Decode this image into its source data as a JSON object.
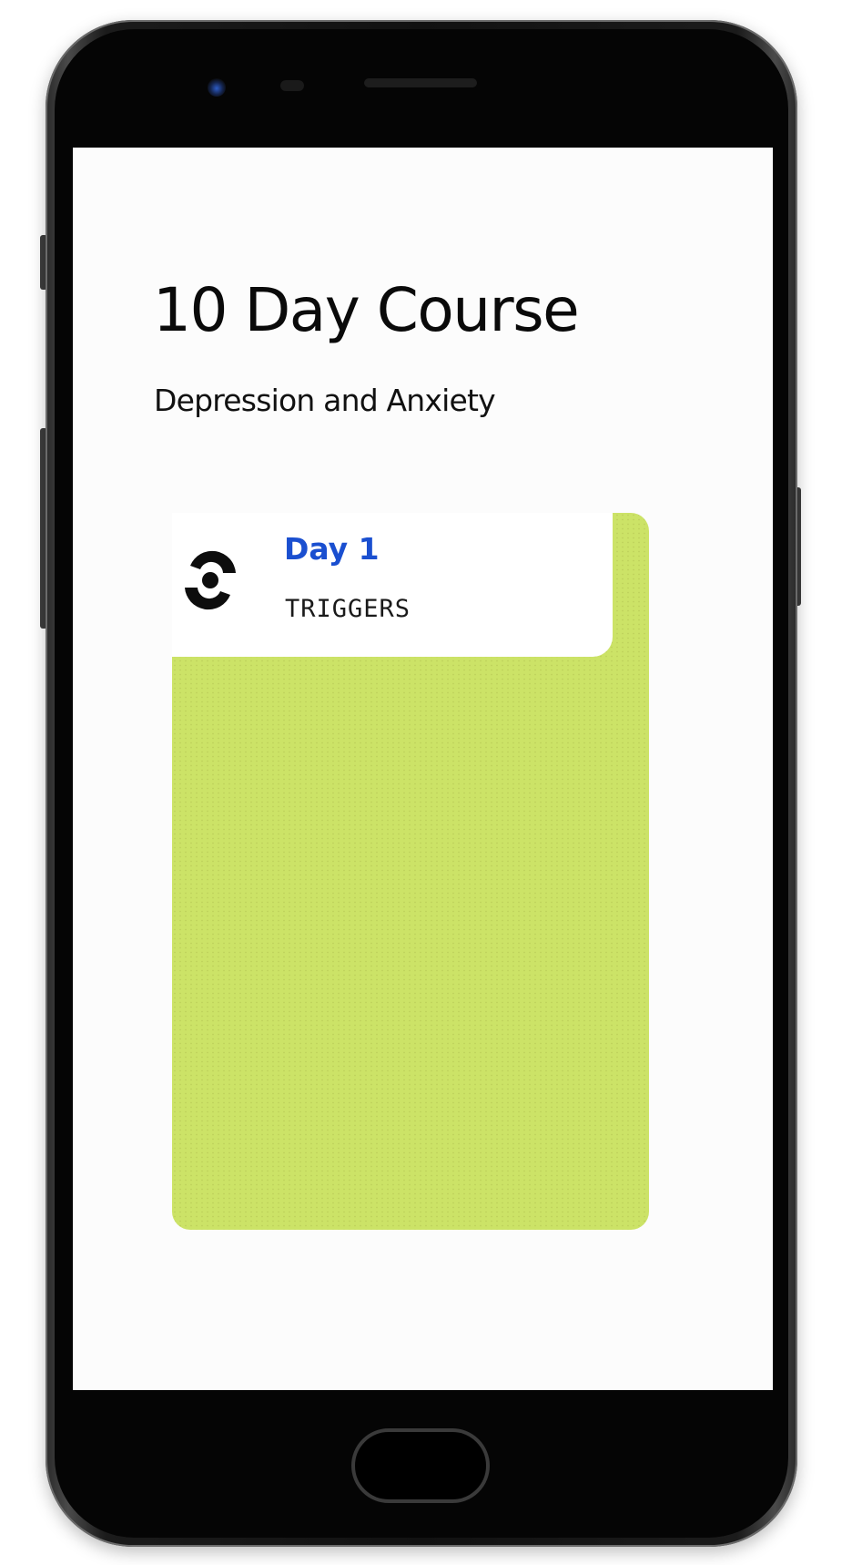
{
  "course": {
    "title": "10 Day Course",
    "subtitle": "Depression and Anxiety"
  },
  "card": {
    "day": "Day 1",
    "topic": "TRIGGERS",
    "icon": "target-swirl-icon",
    "background_color": "#cce367",
    "day_color": "#1a4fd0"
  },
  "device": {
    "type": "phone-frame",
    "home_button_icon": "home-button"
  }
}
